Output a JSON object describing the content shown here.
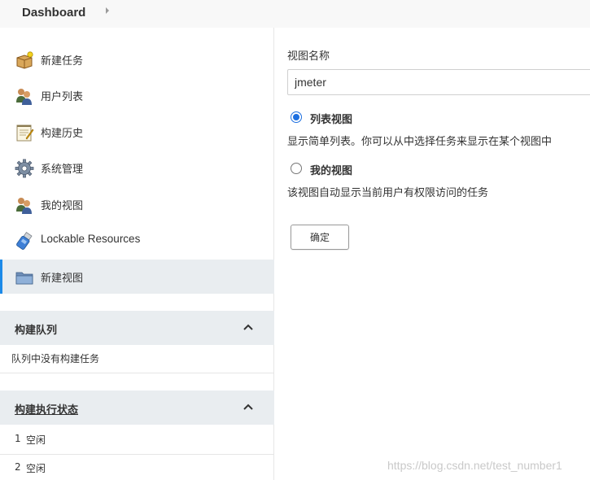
{
  "header": {
    "breadcrumb": "Dashboard"
  },
  "sidebar": {
    "items": [
      {
        "label": "新建任务",
        "icon": "new-item-box-icon"
      },
      {
        "label": "用户列表",
        "icon": "users-icon"
      },
      {
        "label": "构建历史",
        "icon": "notepad-icon"
      },
      {
        "label": "系统管理",
        "icon": "gear-icon"
      },
      {
        "label": "我的视图",
        "icon": "user-view-icon"
      },
      {
        "label": "Lockable Resources",
        "icon": "usb-drive-icon"
      },
      {
        "label": "新建视图",
        "icon": "folder-icon",
        "active": true
      }
    ],
    "build_queue": {
      "title": "构建队列",
      "empty_text": "队列中没有构建任务"
    },
    "executor_status": {
      "title": "构建执行状态",
      "executors": [
        {
          "number": "1",
          "status": "空闲"
        },
        {
          "number": "2",
          "status": "空闲"
        }
      ]
    }
  },
  "form": {
    "name_label": "视图名称",
    "name_value": "jmeter",
    "options": [
      {
        "label": "列表视图",
        "description": "显示简单列表。你可以从中选择任务来显示在某个视图中",
        "checked": true
      },
      {
        "label": "我的视图",
        "description": "该视图自动显示当前用户有权限访问的任务",
        "checked": false
      }
    ],
    "ok_label": "确定"
  },
  "watermark": "https://blog.csdn.net/test_number1",
  "colors": {
    "accent": "#1c6fe0",
    "active_bar": "#1c8ae8",
    "panel_bg": "#e9edf0"
  }
}
